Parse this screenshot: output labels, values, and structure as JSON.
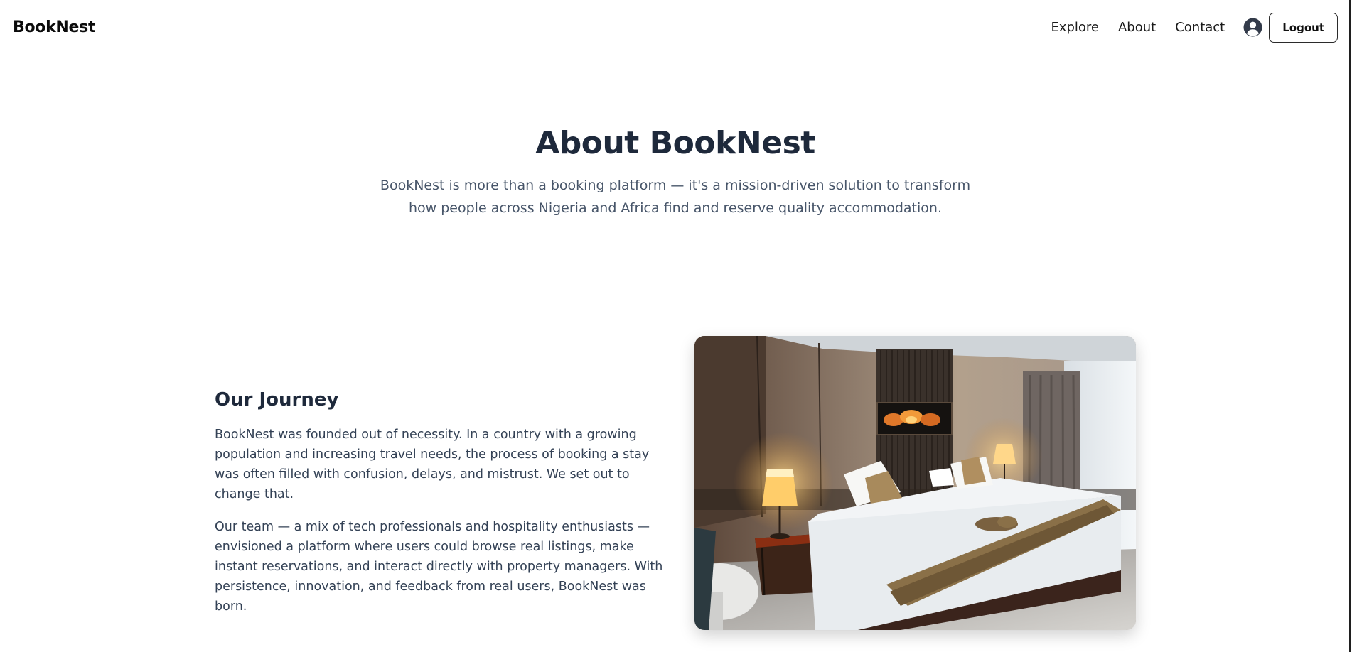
{
  "navbar": {
    "brand": "BookNest",
    "links": [
      "Explore",
      "About",
      "Contact"
    ],
    "user_icon": "user-circle-icon",
    "logout_label": "Logout"
  },
  "hero": {
    "title": "About BookNest",
    "subtitle": "BookNest is more than a booking platform — it's a mission-driven solution to transform how people across Nigeria and Africa find and reserve quality accommodation."
  },
  "journey": {
    "title": "Our Journey",
    "paragraphs": [
      "BookNest was founded out of necessity. In a country with a growing population and increasing travel needs, the process of booking a stay was often filled with confusion, delays, and mistrust. We set out to change that.",
      "Our team — a mix of tech professionals and hospitality enthusiasts — envisioned a platform where users could browse real listings, make instant reservations, and interact directly with property managers. With persistence, innovation, and feedback from real users, BookNest was born."
    ],
    "image_subject": "hotel-bedroom-photo"
  },
  "colors": {
    "heading": "#1e293b",
    "subtext": "#475569",
    "body_text": "#334155",
    "brand_text": "#0b0b0b"
  }
}
